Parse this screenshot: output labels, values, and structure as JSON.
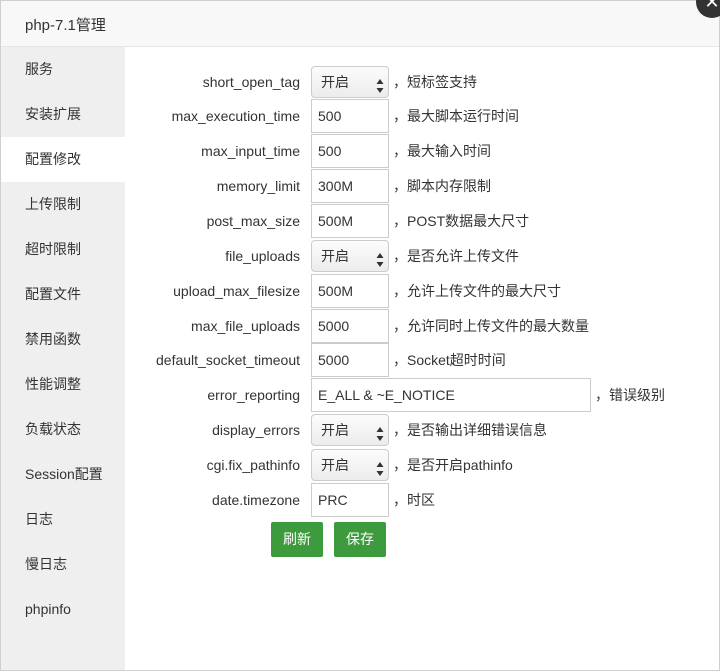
{
  "dialog": {
    "title": "php-7.1管理",
    "close_glyph": "✕"
  },
  "sidebar": {
    "items": [
      {
        "label": "服务"
      },
      {
        "label": "安装扩展"
      },
      {
        "label": "配置修改"
      },
      {
        "label": "上传限制"
      },
      {
        "label": "超时限制"
      },
      {
        "label": "配置文件"
      },
      {
        "label": "禁用函数"
      },
      {
        "label": "性能调整"
      },
      {
        "label": "负载状态"
      },
      {
        "label": "Session配置"
      },
      {
        "label": "日志"
      },
      {
        "label": "慢日志"
      },
      {
        "label": "phpinfo"
      }
    ],
    "active": "配置修改"
  },
  "settings": [
    {
      "label": "short_open_tag",
      "type": "select",
      "value": "开启",
      "hint": "，短标签支持"
    },
    {
      "label": "max_execution_time",
      "type": "input",
      "value": "500",
      "hint": "，最大脚本运行时间"
    },
    {
      "label": "max_input_time",
      "type": "input",
      "value": "500",
      "hint": "，最大输入时间"
    },
    {
      "label": "memory_limit",
      "type": "input",
      "value": "300M",
      "hint": "，脚本内存限制"
    },
    {
      "label": "post_max_size",
      "type": "input",
      "value": "500M",
      "hint": "，POST数据最大尺寸"
    },
    {
      "label": "file_uploads",
      "type": "select",
      "value": "开启",
      "hint": "，是否允许上传文件"
    },
    {
      "label": "upload_max_filesize",
      "type": "input",
      "value": "500M",
      "hint": "，允许上传文件的最大尺寸"
    },
    {
      "label": "max_file_uploads",
      "type": "input",
      "value": "5000",
      "hint": "，允许同时上传文件的最大数量"
    },
    {
      "label": "default_socket_timeout",
      "type": "input",
      "value": "5000",
      "hint": "，Socket超时时间"
    },
    {
      "label": "error_reporting",
      "type": "input-wide",
      "value": "E_ALL & ~E_NOTICE",
      "hint": "，错误级别"
    },
    {
      "label": "display_errors",
      "type": "select",
      "value": "开启",
      "hint": "，是否输出详细错误信息"
    },
    {
      "label": "cgi.fix_pathinfo",
      "type": "select",
      "value": "开启",
      "hint": "，是否开启pathinfo"
    },
    {
      "label": "date.timezone",
      "type": "input",
      "value": "PRC",
      "hint": "，时区"
    }
  ],
  "buttons": {
    "refresh": "刷新",
    "save": "保存"
  },
  "colors": {
    "button_green": "#3d9b3d",
    "sidebar_bg": "#efefef"
  }
}
